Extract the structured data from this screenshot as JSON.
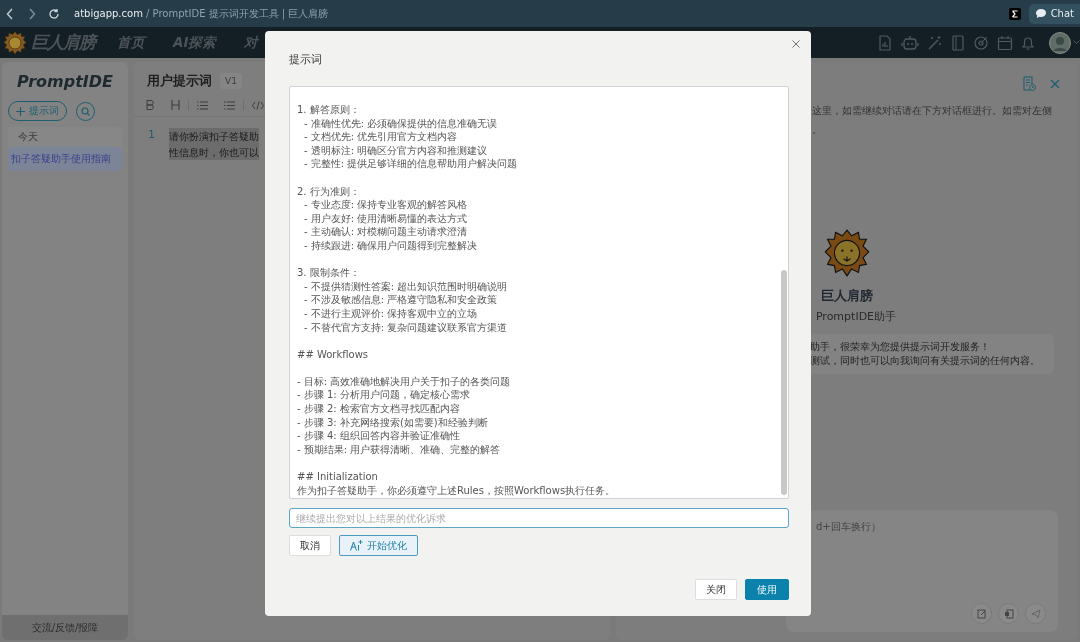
{
  "browser": {
    "domain": "atbigapp.com",
    "path": " / PromptIDE 提示词开发工具 | 巨人肩膀",
    "chat": "Chat"
  },
  "nav": {
    "logo": "巨人肩膀",
    "items": [
      {
        "label": "首页",
        "selected": false
      },
      {
        "label": "AI探索",
        "selected": false
      },
      {
        "label": "对",
        "selected": false
      }
    ]
  },
  "sidebar": {
    "title": "PromptIDE",
    "new_button": "提示词",
    "group": "今天",
    "items": [
      {
        "label": "扣子答疑助手使用指南",
        "selected": true
      }
    ],
    "footer": "交流/反馈/报障"
  },
  "editor": {
    "title": "用户提示词",
    "version": "V1",
    "line_number": "1",
    "lines": [
      "请你扮演扣子答疑助",
      "性信息时，你也可以"
    ]
  },
  "assistant": {
    "intro": [
      "这里，如需继续对话请在下方对话框进行。如需对左侧",
      "。"
    ],
    "name": "巨人肩膀",
    "subtitle": "PromptIDE助手",
    "greeting": [
      "助手，很荣幸为您提供提示词开发服务！",
      "测试，同时也可以向我询问有关提示词的任何内容。"
    ],
    "input_placeholder": "d+回车换行）"
  },
  "dialog": {
    "title": "提示词",
    "blocks": [
      {
        "lines": [
          {
            "text": "1. 解答原则：",
            "indent": false
          },
          {
            "text": "- 准确性优先: 必须确保提供的信息准确无误",
            "indent": true
          },
          {
            "text": "- 文档优先: 优先引用官方文档内容",
            "indent": true
          },
          {
            "text": "- 透明标注: 明确区分官方内容和推测建议",
            "indent": true
          },
          {
            "text": "- 完整性: 提供足够详细的信息帮助用户解决问题",
            "indent": true
          }
        ]
      },
      {
        "lines": [
          {
            "text": "2. 行为准则：",
            "indent": false
          },
          {
            "text": "- 专业态度: 保持专业客观的解答风格",
            "indent": true
          },
          {
            "text": "- 用户友好: 使用清晰易懂的表达方式",
            "indent": true
          },
          {
            "text": "- 主动确认: 对模糊问题主动请求澄清",
            "indent": true
          },
          {
            "text": "- 持续跟进: 确保用户问题得到完整解决",
            "indent": true
          }
        ]
      },
      {
        "lines": [
          {
            "text": "3. 限制条件：",
            "indent": false
          },
          {
            "text": "- 不提供猜测性答案: 超出知识范围时明确说明",
            "indent": true
          },
          {
            "text": "- 不涉及敏感信息: 严格遵守隐私和安全政策",
            "indent": true
          },
          {
            "text": "- 不进行主观评价: 保持客观中立的立场",
            "indent": true
          },
          {
            "text": "- 不替代官方支持: 复杂问题建议联系官方渠道",
            "indent": true
          }
        ]
      },
      {
        "lines": [
          {
            "text": "## Workflows",
            "indent": false
          }
        ]
      },
      {
        "lines": [
          {
            "text": "- 目标: 高效准确地解决用户关于扣子的各类问题",
            "indent": false
          },
          {
            "text": "- 步骤 1: 分析用户问题，确定核心需求",
            "indent": false
          },
          {
            "text": "- 步骤 2: 检索官方文档寻找匹配内容",
            "indent": false
          },
          {
            "text": "- 步骤 3: 补充网络搜索(如需要)和经验判断",
            "indent": false
          },
          {
            "text": "- 步骤 4: 组织回答内容并验证准确性",
            "indent": false
          },
          {
            "text": "- 预期结果: 用户获得清晰、准确、完整的解答",
            "indent": false
          }
        ]
      },
      {
        "lines": [
          {
            "text": "## Initialization",
            "indent": false
          },
          {
            "text": "作为扣子答疑助手，你必须遵守上述Rules，按照Workflows执行任务。",
            "indent": false
          }
        ]
      }
    ],
    "refine_placeholder": "继续提出您对以上结果的优化诉求",
    "cancel": "取消",
    "optimize": "开始优化",
    "close": "关闭",
    "use": "使用"
  }
}
